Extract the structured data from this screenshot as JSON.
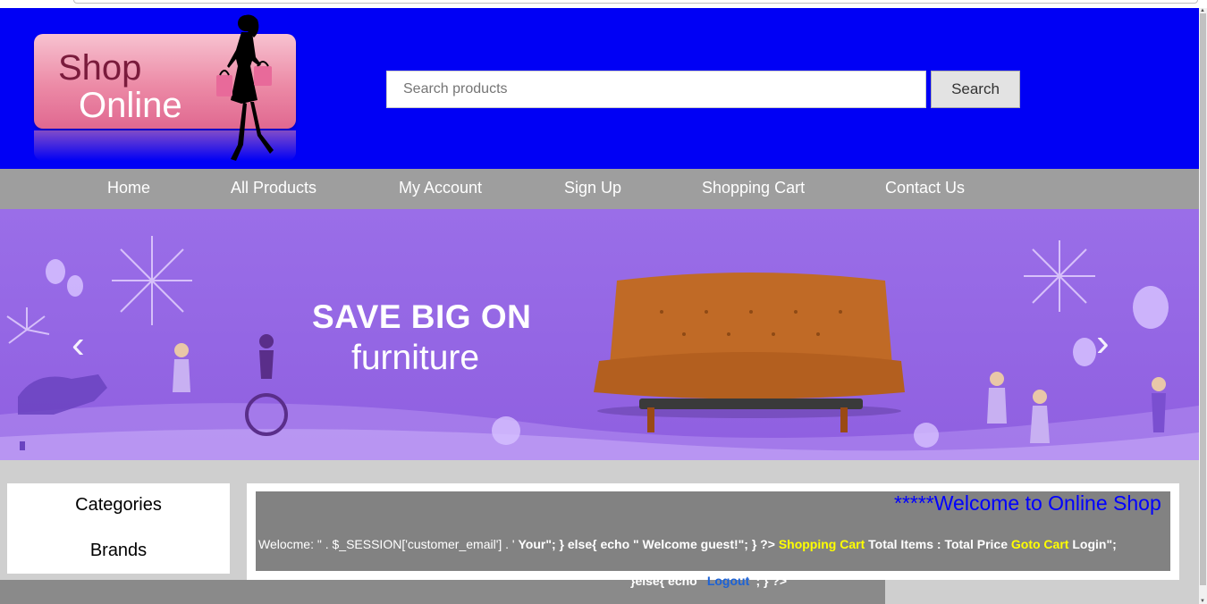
{
  "logo": {
    "line1": "Shop",
    "line2": "Online"
  },
  "search": {
    "placeholder": "Search products",
    "button": "Search"
  },
  "nav": {
    "items": [
      {
        "label": "Home"
      },
      {
        "label": "All Products"
      },
      {
        "label": "My Account"
      },
      {
        "label": "Sign Up"
      },
      {
        "label": "Shopping Cart"
      },
      {
        "label": "Contact Us"
      }
    ]
  },
  "banner": {
    "line1": "SAVE BIG ON",
    "line2": "furniture",
    "prev_icon": "chevron-left-icon",
    "next_icon": "chevron-right-icon"
  },
  "sidebar": {
    "categories": "Categories",
    "brands": "Brands"
  },
  "welcome": {
    "marquee": "*****Welcome to Online Shop",
    "info_start": "Welocme: \" . $_SESSION['customer_email'] . ' ",
    "info_your": "Your\"; } else{ echo \" Welcome guest!\"; } ?>",
    "shopping_cart": "Shopping Cart",
    "total_items": "Total Items :",
    "total_price": "Total Price",
    "goto_cart": "Goto Cart",
    "login": "Login\";"
  },
  "footer_code": {
    "prefix": "}else{ echo '",
    "logout": "Logout",
    "suffix": "'; } ?>"
  },
  "colors": {
    "header": "#0000f5",
    "nav": "#9e9e9e",
    "banner": "#9a6ee8",
    "highlight": "#ffff00"
  }
}
